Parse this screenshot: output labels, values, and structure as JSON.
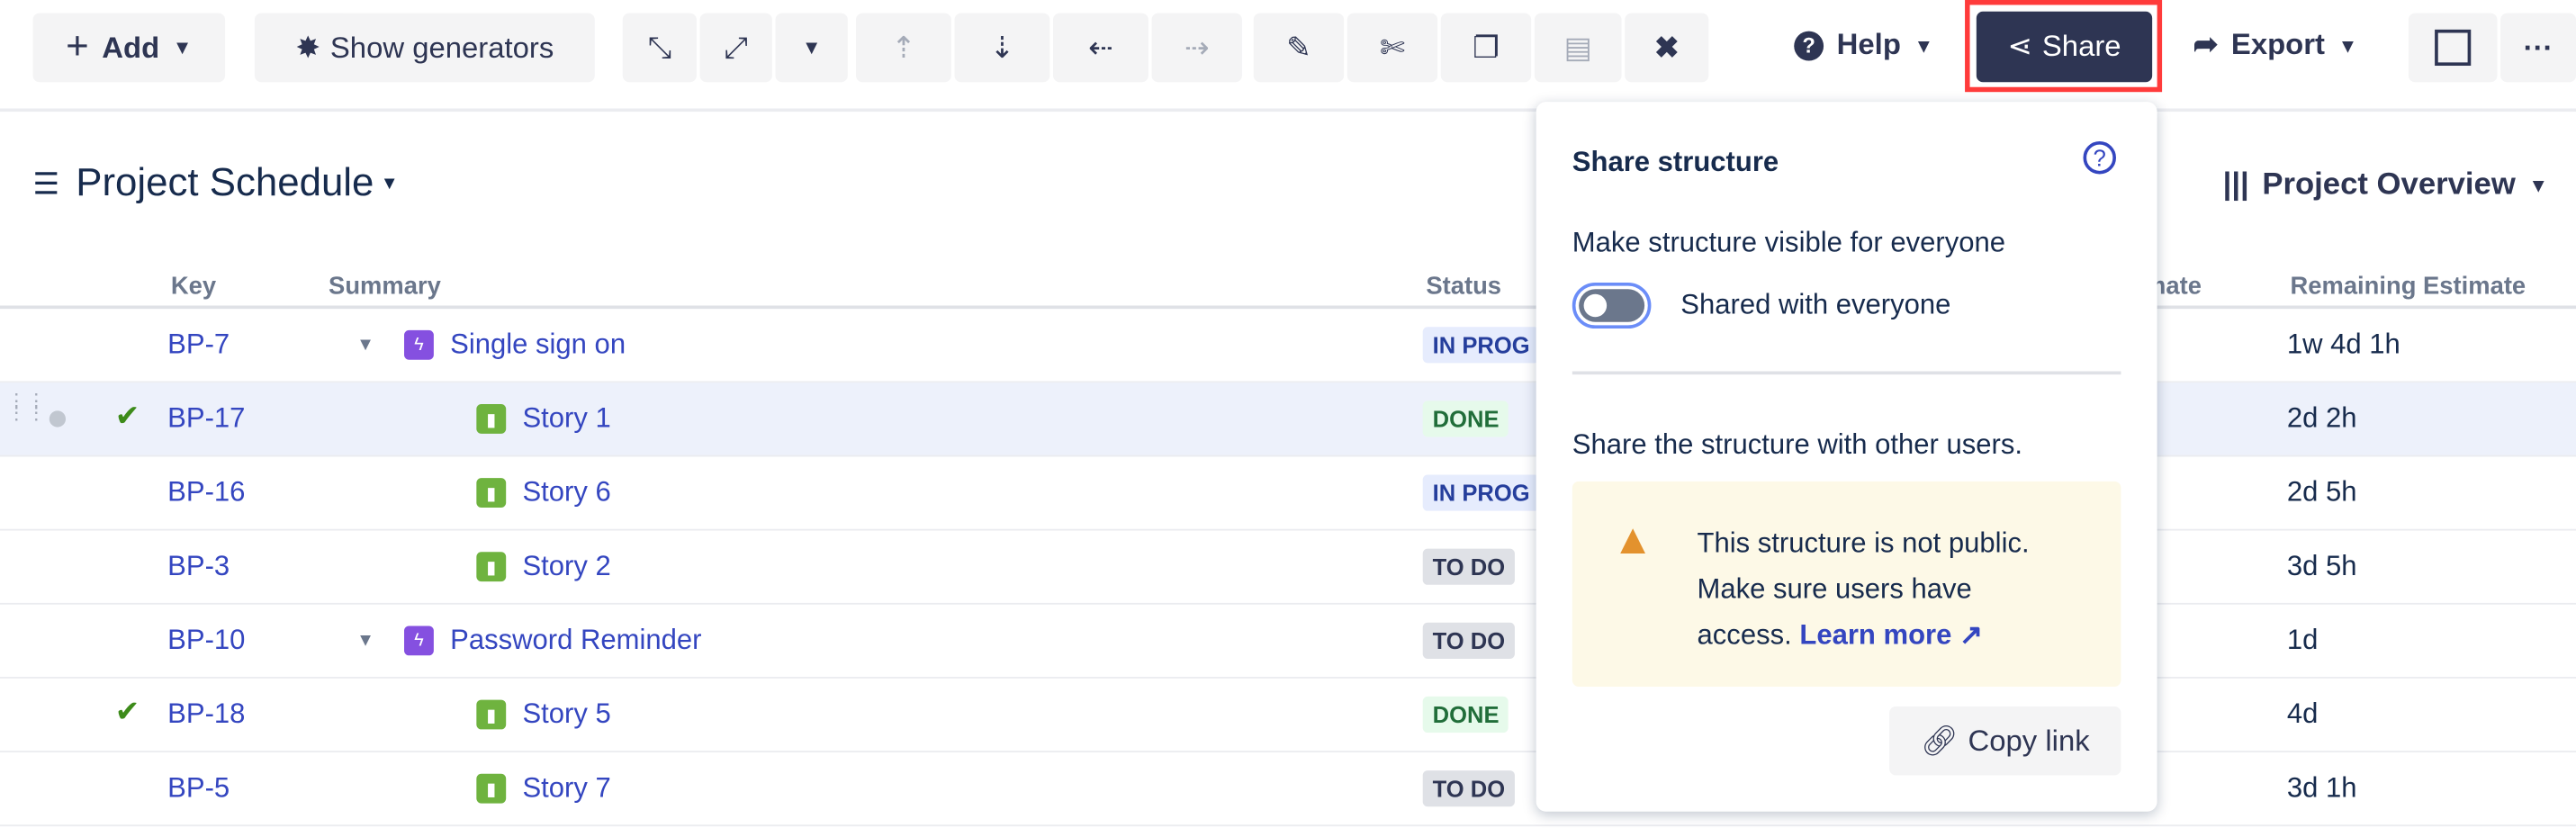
{
  "toolbar": {
    "add_label": "Add",
    "show_generators_label": "Show generators",
    "help_label": "Help",
    "share_label": "Share",
    "export_label": "Export",
    "icons": [
      "expand-icon",
      "collapse-icon",
      "chevron-down-icon",
      "move-up-icon",
      "move-down-icon",
      "outdent-icon",
      "indent-icon",
      "edit-icon",
      "cut-icon",
      "copy-icon",
      "paste-icon",
      "delete-icon"
    ],
    "accent": "#2e3553",
    "highlight": "#ff3b3b"
  },
  "structure": {
    "title": "Project Schedule",
    "view": "Project Overview"
  },
  "table": {
    "columns": {
      "key": "Key",
      "summary": "Summary",
      "status": "Status",
      "original": "mate",
      "remaining": "Remaining Estimate"
    },
    "rows": [
      {
        "key": "BP-7",
        "summary": "Single sign on",
        "type": "epic",
        "status": "IN PROG",
        "status_kind": "prog",
        "remaining": "1w 4d 1h",
        "expandable": true,
        "check": false,
        "selected": false
      },
      {
        "key": "BP-17",
        "summary": "Story 1",
        "type": "story",
        "status": "DONE",
        "status_kind": "done",
        "remaining": "2d 2h",
        "check": true,
        "selected": true
      },
      {
        "key": "BP-16",
        "summary": "Story 6",
        "type": "story",
        "status": "IN PROG",
        "status_kind": "prog",
        "remaining": "2d 5h",
        "check": false,
        "selected": false
      },
      {
        "key": "BP-3",
        "summary": "Story 2",
        "type": "story",
        "status": "TO DO",
        "status_kind": "todo",
        "remaining": "3d 5h",
        "check": false,
        "selected": false
      },
      {
        "key": "BP-10",
        "summary": "Password Reminder",
        "type": "epic",
        "status": "TO DO",
        "status_kind": "todo",
        "remaining": "1d",
        "expandable": true,
        "check": false,
        "selected": false
      },
      {
        "key": "BP-18",
        "summary": "Story 5",
        "type": "story",
        "status": "DONE",
        "status_kind": "done",
        "remaining": "4d",
        "check": true,
        "selected": false
      },
      {
        "key": "BP-5",
        "summary": "Story 7",
        "type": "story",
        "status": "TO DO",
        "status_kind": "todo",
        "remaining": "3d 1h",
        "check": false,
        "selected": false
      }
    ]
  },
  "share_popup": {
    "title": "Share structure",
    "visible_label": "Make structure visible for everyone",
    "toggle_label": "Shared with everyone",
    "toggle_on": false,
    "users_label": "Share the structure with other users.",
    "warning_line1": "This structure is not public.",
    "warning_line2": "Make sure users have",
    "warning_line3": "access.",
    "learn_more": "Learn more ↗",
    "copy_link": "Copy link"
  }
}
